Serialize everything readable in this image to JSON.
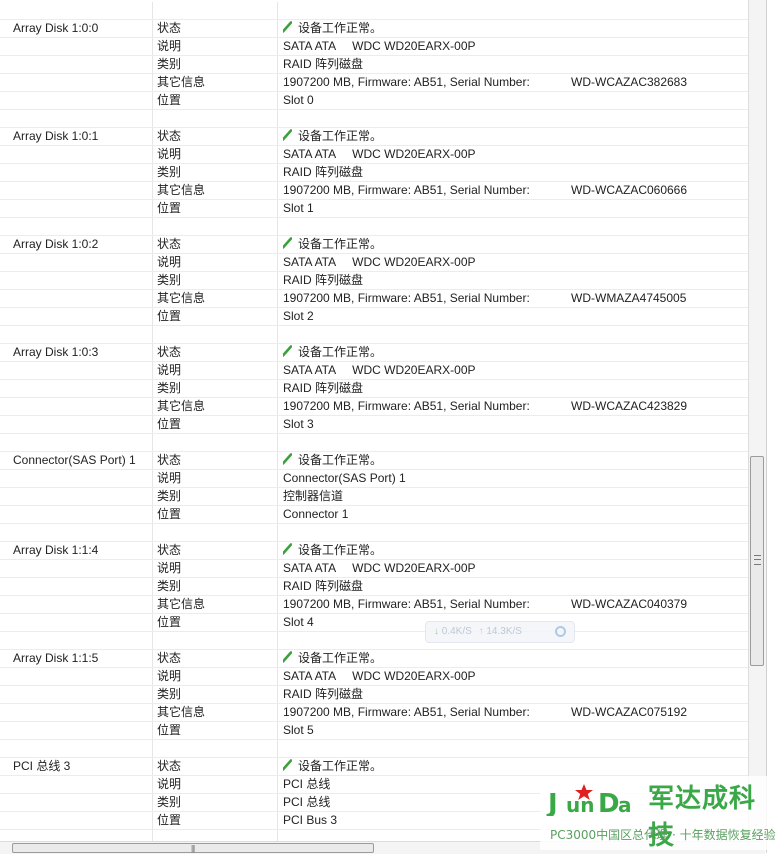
{
  "devices": [
    {
      "name": "Array Disk 1:0:0",
      "props": [
        {
          "key": "状态",
          "value": "设备工作正常。",
          "ok": true
        },
        {
          "key": "说明",
          "value": "SATA ATA     WDC WD20EARX-00P"
        },
        {
          "key": "类别",
          "value": "RAID 阵列磁盘"
        },
        {
          "key": "其它信息",
          "value": "1907200 MB, Firmware: AB51, Serial Number:",
          "serial": "WD-WCAZAC382683"
        },
        {
          "key": "位置",
          "value": "Slot 0"
        }
      ]
    },
    {
      "name": "Array Disk 1:0:1",
      "props": [
        {
          "key": "状态",
          "value": "设备工作正常。",
          "ok": true
        },
        {
          "key": "说明",
          "value": "SATA ATA     WDC WD20EARX-00P"
        },
        {
          "key": "类别",
          "value": "RAID 阵列磁盘"
        },
        {
          "key": "其它信息",
          "value": "1907200 MB, Firmware: AB51, Serial Number:",
          "serial": "WD-WCAZAC060666"
        },
        {
          "key": "位置",
          "value": "Slot 1"
        }
      ]
    },
    {
      "name": "Array Disk 1:0:2",
      "props": [
        {
          "key": "状态",
          "value": "设备工作正常。",
          "ok": true
        },
        {
          "key": "说明",
          "value": "SATA ATA     WDC WD20EARX-00P"
        },
        {
          "key": "类别",
          "value": "RAID 阵列磁盘"
        },
        {
          "key": "其它信息",
          "value": "1907200 MB, Firmware: AB51, Serial Number:",
          "serial": "WD-WMAZA4745005"
        },
        {
          "key": "位置",
          "value": "Slot 2"
        }
      ]
    },
    {
      "name": "Array Disk 1:0:3",
      "props": [
        {
          "key": "状态",
          "value": "设备工作正常。",
          "ok": true
        },
        {
          "key": "说明",
          "value": "SATA ATA     WDC WD20EARX-00P"
        },
        {
          "key": "类别",
          "value": "RAID 阵列磁盘"
        },
        {
          "key": "其它信息",
          "value": "1907200 MB, Firmware: AB51, Serial Number:",
          "serial": "WD-WCAZAC423829"
        },
        {
          "key": "位置",
          "value": "Slot 3"
        }
      ]
    },
    {
      "name": "Connector(SAS Port) 1",
      "props": [
        {
          "key": "状态",
          "value": "设备工作正常。",
          "ok": true
        },
        {
          "key": "说明",
          "value": "Connector(SAS Port) 1"
        },
        {
          "key": "类别",
          "value": "控制器信道"
        },
        {
          "key": "位置",
          "value": "Connector 1"
        }
      ]
    },
    {
      "name": "Array Disk 1:1:4",
      "props": [
        {
          "key": "状态",
          "value": "设备工作正常。",
          "ok": true
        },
        {
          "key": "说明",
          "value": "SATA ATA     WDC WD20EARX-00P"
        },
        {
          "key": "类别",
          "value": "RAID 阵列磁盘"
        },
        {
          "key": "其它信息",
          "value": "1907200 MB, Firmware: AB51, Serial Number:",
          "serial": "WD-WCAZAC040379"
        },
        {
          "key": "位置",
          "value": "Slot 4"
        }
      ]
    },
    {
      "name": "Array Disk 1:1:5",
      "props": [
        {
          "key": "状态",
          "value": "设备工作正常。",
          "ok": true
        },
        {
          "key": "说明",
          "value": "SATA ATA     WDC WD20EARX-00P"
        },
        {
          "key": "类别",
          "value": "RAID 阵列磁盘"
        },
        {
          "key": "其它信息",
          "value": "1907200 MB, Firmware: AB51, Serial Number:",
          "serial": "WD-WCAZAC075192"
        },
        {
          "key": "位置",
          "value": "Slot 5"
        }
      ]
    },
    {
      "name": "PCI 总线 3",
      "props": [
        {
          "key": "状态",
          "value": "设备工作正常。",
          "ok": true
        },
        {
          "key": "说明",
          "value": "PCI 总线"
        },
        {
          "key": "类别",
          "value": "PCI 总线"
        },
        {
          "key": "位置",
          "value": "PCI Bus 3"
        }
      ]
    }
  ],
  "speed_widget": {
    "down": "0.4K/S",
    "up": "14.3K/S"
  },
  "watermark": {
    "logo_text": "JunDa",
    "brand": "军达成科技",
    "subtitle": "PC3000中国区总代理 · 十年数据恢复经验"
  },
  "colors": {
    "ok_check": "#3aa33a",
    "grid_line": "#ececec",
    "brand_green": "#3aa847",
    "brand_red": "#e02020"
  }
}
